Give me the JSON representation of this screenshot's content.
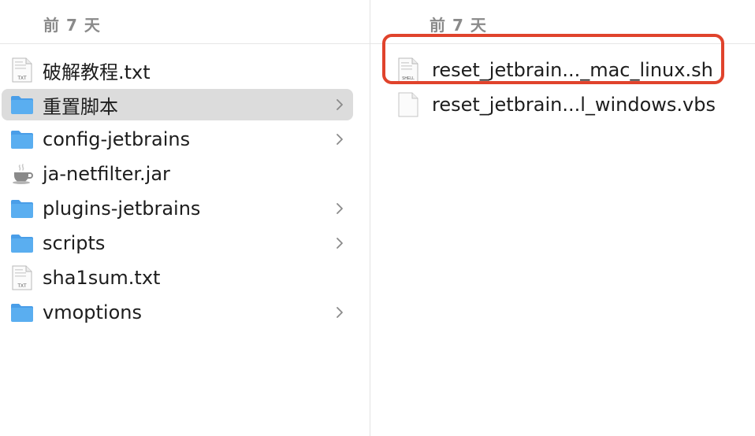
{
  "left_column": {
    "header_label": "前 7 天",
    "items": [
      {
        "name": "破解教程.txt",
        "icon": "txt-file-icon",
        "folder": false
      },
      {
        "name": "重置脚本",
        "icon": "folder-icon",
        "folder": true,
        "selected": true
      },
      {
        "name": "config-jetbrains",
        "icon": "folder-icon",
        "folder": true
      },
      {
        "name": "ja-netfilter.jar",
        "icon": "java-jar-icon",
        "folder": false
      },
      {
        "name": "plugins-jetbrains",
        "icon": "folder-icon",
        "folder": true
      },
      {
        "name": "scripts",
        "icon": "folder-icon",
        "folder": true
      },
      {
        "name": "sha1sum.txt",
        "icon": "txt-file-icon",
        "folder": false
      },
      {
        "name": "vmoptions",
        "icon": "folder-icon",
        "folder": true
      }
    ]
  },
  "right_column": {
    "header_label": "前 7 天",
    "items": [
      {
        "name": "reset_jetbrain..._mac_linux.sh",
        "icon": "shell-file-icon",
        "highlighted": true
      },
      {
        "name": "reset_jetbrain...l_windows.vbs",
        "icon": "blank-file-icon"
      }
    ]
  },
  "icon_labels": {
    "txt": "TXT",
    "shell": "SHELL"
  },
  "colors": {
    "folder": "#5aaef0",
    "selection": "#dcdcdc",
    "highlight": "#e0432c"
  }
}
